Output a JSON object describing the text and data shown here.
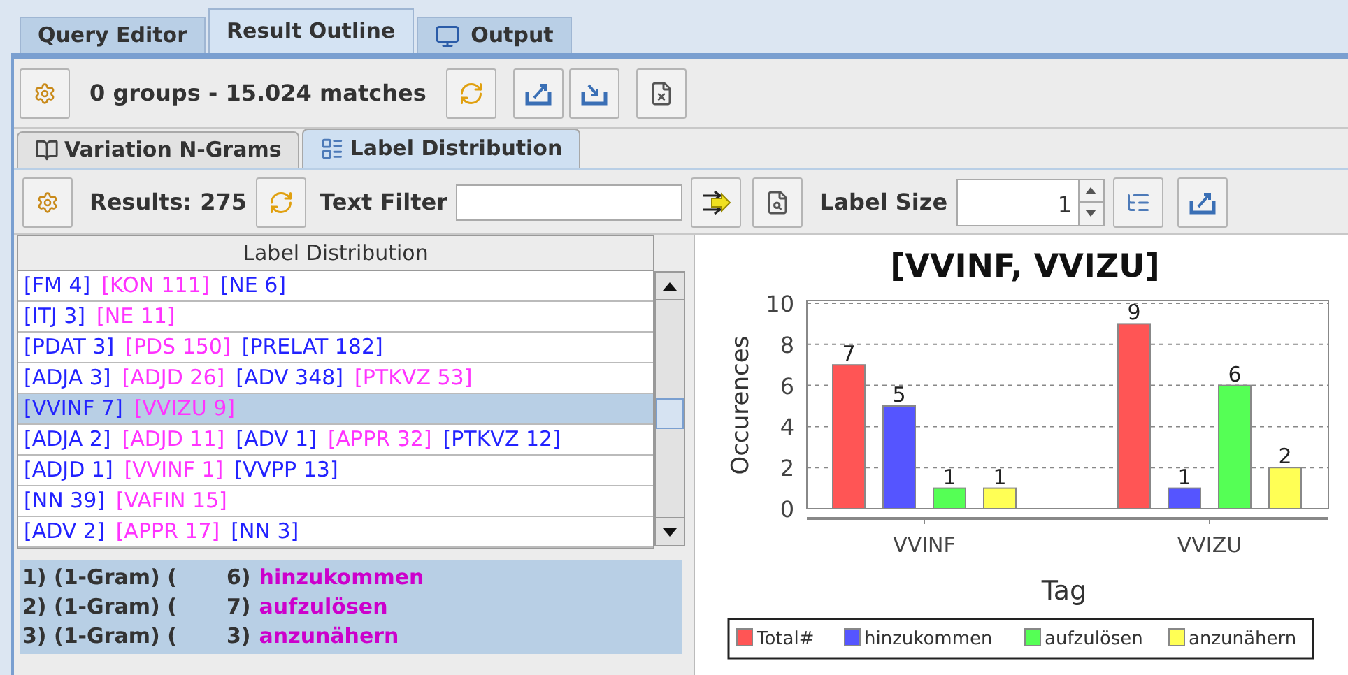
{
  "tabs": [
    {
      "label": "Query Editor",
      "selected": false
    },
    {
      "label": "Result Outline",
      "selected": true
    },
    {
      "label": "Output",
      "selected": false
    }
  ],
  "toolbar": {
    "summary": "0 groups - 15.024 matches"
  },
  "subtabs": [
    {
      "label": "Variation N-Grams",
      "selected": false
    },
    {
      "label": "Label Distribution",
      "selected": true
    }
  ],
  "filter_bar": {
    "results_label": "Results:",
    "results_count": "275",
    "text_filter_label": "Text Filter",
    "label_size_label": "Label Size",
    "label_size_value": "1"
  },
  "label_list": {
    "header": "Label Distribution",
    "rows": [
      {
        "selected": false,
        "segments": [
          {
            "text": "[FM 4]",
            "color": "#2222ff"
          },
          {
            "text": "[KON 111]",
            "color": "#ff33ff"
          },
          {
            "text": "[NE 6]",
            "color": "#2222ff"
          }
        ]
      },
      {
        "selected": false,
        "segments": [
          {
            "text": "[ITJ 3]",
            "color": "#2222ff"
          },
          {
            "text": "[NE 11]",
            "color": "#ff33ff"
          }
        ]
      },
      {
        "selected": false,
        "segments": [
          {
            "text": "[PDAT 3]",
            "color": "#2222ff"
          },
          {
            "text": "[PDS 150]",
            "color": "#ff33ff"
          },
          {
            "text": "[PRELAT 182]",
            "color": "#2222ff"
          }
        ]
      },
      {
        "selected": false,
        "segments": [
          {
            "text": "[ADJA 3]",
            "color": "#2222ff"
          },
          {
            "text": "[ADJD 26]",
            "color": "#ff33ff"
          },
          {
            "text": "[ADV 348]",
            "color": "#2222ff"
          },
          {
            "text": "[PTKVZ 53]",
            "color": "#ff33ff"
          }
        ]
      },
      {
        "selected": true,
        "segments": [
          {
            "text": "[VVINF 7]",
            "color": "#2222ff"
          },
          {
            "text": "[VVIZU 9]",
            "color": "#ff33ff"
          }
        ]
      },
      {
        "selected": false,
        "segments": [
          {
            "text": "[ADJA 2]",
            "color": "#2222ff"
          },
          {
            "text": "[ADJD 11]",
            "color": "#ff33ff"
          },
          {
            "text": "[ADV 1]",
            "color": "#2222ff"
          },
          {
            "text": "[APPR 32]",
            "color": "#ff33ff"
          },
          {
            "text": "[PTKVZ 12]",
            "color": "#2222ff"
          }
        ]
      },
      {
        "selected": false,
        "segments": [
          {
            "text": "[ADJD 1]",
            "color": "#2222ff"
          },
          {
            "text": "[VVINF 1]",
            "color": "#ff33ff"
          },
          {
            "text": "[VVPP 13]",
            "color": "#2222ff"
          }
        ]
      },
      {
        "selected": false,
        "segments": [
          {
            "text": "[NN 39]",
            "color": "#2222ff"
          },
          {
            "text": "[VAFIN 15]",
            "color": "#ff33ff"
          }
        ]
      },
      {
        "selected": false,
        "segments": [
          {
            "text": "[ADV 2]",
            "color": "#2222ff"
          },
          {
            "text": "[APPR 17]",
            "color": "#ff33ff"
          },
          {
            "text": "[NN 3]",
            "color": "#2222ff"
          }
        ]
      }
    ]
  },
  "ngram_details": [
    {
      "prefix": "1) (1-Gram) (",
      "count": "6)",
      "term": "hinzukommen"
    },
    {
      "prefix": "2) (1-Gram) (",
      "count": "7)",
      "term": "aufzulösen"
    },
    {
      "prefix": "3) (1-Gram) (",
      "count": "3)",
      "term": "anzunähern"
    }
  ],
  "chart": {
    "chart_data": {
      "type": "bar",
      "title": "[VVINF, VVIZU]",
      "xlabel": "Tag",
      "ylabel": "Occurences",
      "categories": [
        "VVINF",
        "VVIZU"
      ],
      "series": [
        {
          "name": "Total#",
          "color": "#ff5555",
          "values": [
            7,
            9
          ]
        },
        {
          "name": "hinzukommen",
          "color": "#5555ff",
          "values": [
            5,
            1
          ]
        },
        {
          "name": "aufzulösen",
          "color": "#55ff55",
          "values": [
            1,
            6
          ]
        },
        {
          "name": "anzunähern",
          "color": "#ffff55",
          "values": [
            1,
            2
          ]
        }
      ],
      "ylim": [
        0,
        10
      ],
      "yticks": [
        0,
        2,
        4,
        6,
        8,
        10
      ],
      "data_labels": true,
      "grid": true,
      "legend": "bottom"
    }
  }
}
